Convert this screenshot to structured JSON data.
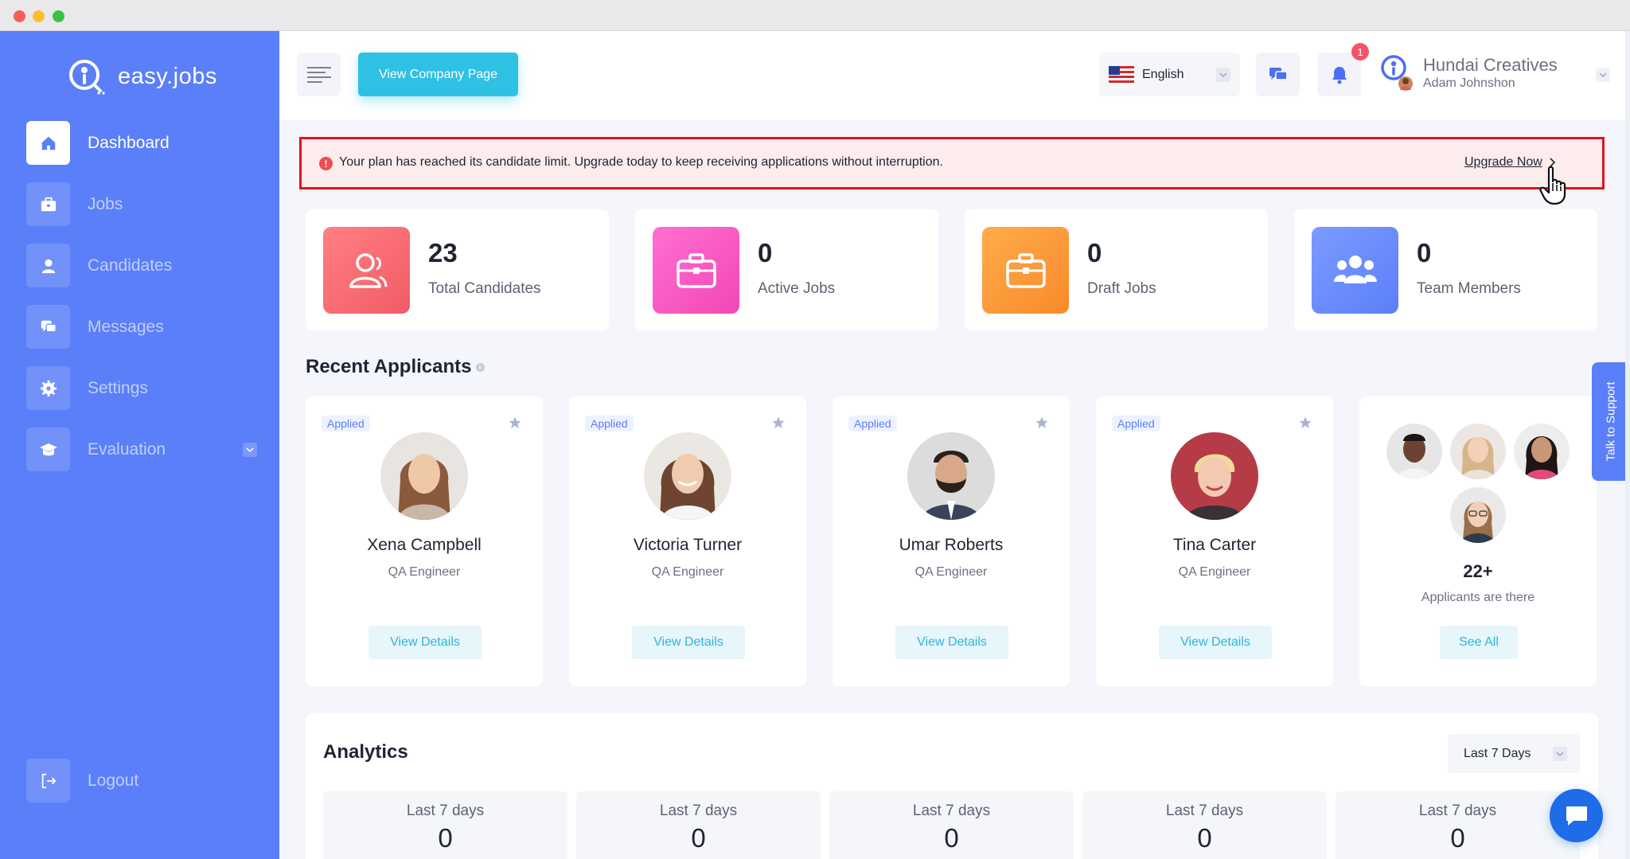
{
  "brand": {
    "name": "easy.jobs"
  },
  "sidebar": {
    "items": [
      {
        "label": "Dashboard",
        "icon": "home-icon",
        "active": true
      },
      {
        "label": "Jobs",
        "icon": "briefcase-icon",
        "active": false
      },
      {
        "label": "Candidates",
        "icon": "user-icon",
        "active": false
      },
      {
        "label": "Messages",
        "icon": "chat-icon",
        "active": false
      },
      {
        "label": "Settings",
        "icon": "gear-icon",
        "active": false
      },
      {
        "label": "Evaluation",
        "icon": "graduation-cap-icon",
        "active": false
      }
    ],
    "logout_label": "Logout"
  },
  "header": {
    "company_page_label": "View Company Page",
    "language": "English",
    "notification_count": "1",
    "company_name": "Hundai Creatives",
    "user_name": "Adam Johnshon"
  },
  "alert": {
    "message": "Your plan has reached its candidate limit. Upgrade today to keep receiving applications without interruption.",
    "link_label": "Upgrade Now"
  },
  "stats": [
    {
      "value": "23",
      "label": "Total Candidates",
      "color": "#f5686f"
    },
    {
      "value": "0",
      "label": "Active Jobs",
      "color": "#fb5bc4"
    },
    {
      "value": "0",
      "label": "Draft Jobs",
      "color": "#fd9a3b"
    },
    {
      "value": "0",
      "label": "Team Members",
      "color": "#6287f9"
    }
  ],
  "recent_applicants": {
    "title": "Recent Applicants",
    "items": [
      {
        "status": "Applied",
        "name": "Xena Campbell",
        "role": "QA Engineer",
        "button": "View Details"
      },
      {
        "status": "Applied",
        "name": "Victoria Turner",
        "role": "QA Engineer",
        "button": "View Details"
      },
      {
        "status": "Applied",
        "name": "Umar Roberts",
        "role": "QA Engineer",
        "button": "View Details"
      },
      {
        "status": "Applied",
        "name": "Tina Carter",
        "role": "QA Engineer",
        "button": "View Details"
      }
    ],
    "more": {
      "count": "22+",
      "text": "Applicants are there",
      "button": "See All"
    }
  },
  "analytics": {
    "title": "Analytics",
    "range": "Last 7 Days",
    "cards": [
      {
        "label": "Last 7 days",
        "value": "0"
      },
      {
        "label": "Last 7 days",
        "value": "0"
      },
      {
        "label": "Last 7 days",
        "value": "0"
      },
      {
        "label": "Last 7 days",
        "value": "0"
      },
      {
        "label": "Last 7 days",
        "value": "0"
      }
    ]
  },
  "support_label": "Talk to Support",
  "colors": {
    "sidebar": "#5b7ff9",
    "accent": "#2fc1e4",
    "alert_border": "#e8101a"
  }
}
